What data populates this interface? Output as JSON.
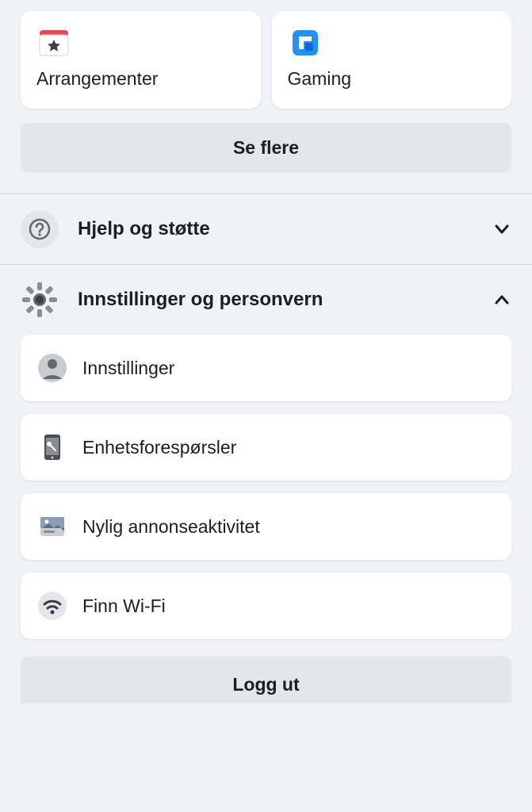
{
  "shortcuts": {
    "events": {
      "label": "Arrangementer"
    },
    "gaming": {
      "label": "Gaming"
    }
  },
  "buttons": {
    "see_more": "Se flere",
    "logout": "Logg ut"
  },
  "sections": {
    "help": {
      "title": "Hjelp og støtte"
    },
    "settings_privacy": {
      "title": "Innstillinger og personvern"
    }
  },
  "settings_items": {
    "settings": {
      "label": "Innstillinger"
    },
    "device_requests": {
      "label": "Enhetsforespørsler"
    },
    "recent_ad_activity": {
      "label": "Nylig annonseaktivitet"
    },
    "find_wifi": {
      "label": "Finn Wi-Fi"
    }
  }
}
